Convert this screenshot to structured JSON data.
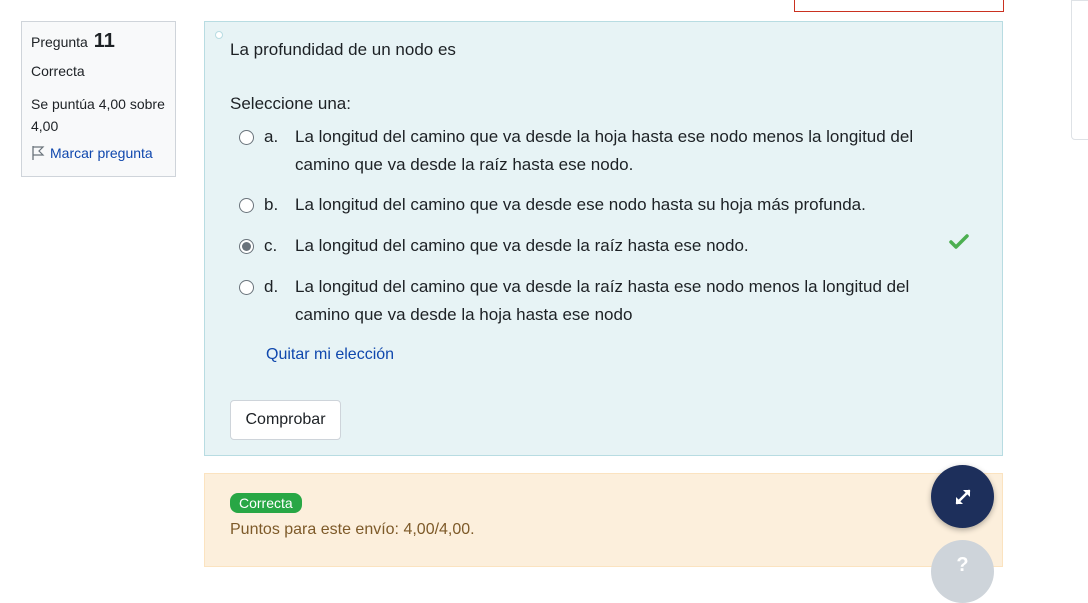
{
  "info": {
    "question_label": "Pregunta",
    "question_number": "11",
    "state": "Correcta",
    "grade": "Se puntúa 4,00 sobre 4,00",
    "flag_label": "Marcar pregunta"
  },
  "question": {
    "text": "La profundidad de un nodo es",
    "prompt": "Seleccione una:",
    "answers": [
      {
        "letter": "a.",
        "text": "La longitud del camino que va desde la hoja hasta ese nodo menos la longitud del camino que va desde la raíz hasta ese nodo.",
        "selected": false
      },
      {
        "letter": "b.",
        "text": "La longitud del camino que va desde ese nodo hasta su hoja más profunda.",
        "selected": false
      },
      {
        "letter": "c.",
        "text": "La longitud del camino que va desde la raíz hasta ese nodo.",
        "selected": true
      },
      {
        "letter": "d.",
        "text": "La longitud del camino que va desde la raíz hasta ese nodo menos la longitud del camino que va desde la hoja hasta ese nodo",
        "selected": false
      }
    ],
    "clear_label": "Quitar mi elección",
    "check_label": "Comprobar"
  },
  "feedback": {
    "badge": "Correcta",
    "points": "Puntos para este envío: 4,00/4,00."
  },
  "floating": {
    "fab2_glyph": "?"
  },
  "colors": {
    "accent": "#0f47ad",
    "correct": "#28a745",
    "fab": "#1d2f5b"
  },
  "icons": [
    "flag-icon",
    "check-icon",
    "expand-icon"
  ]
}
